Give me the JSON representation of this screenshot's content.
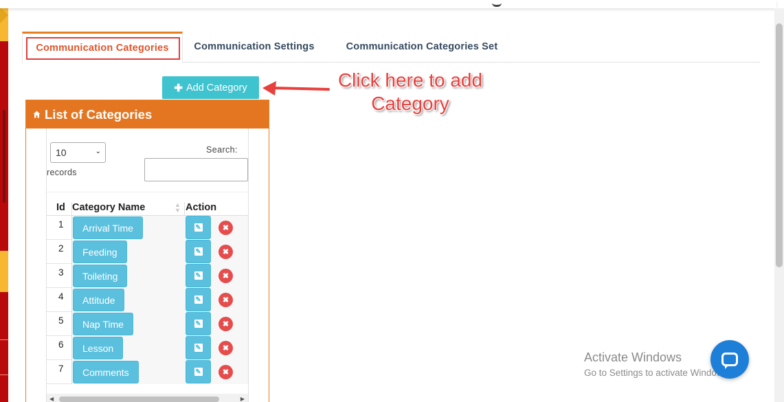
{
  "tabs": [
    {
      "label": "Communication Categories",
      "active": true
    },
    {
      "label": "Communication Settings",
      "active": false
    },
    {
      "label": "Communication Categories Set",
      "active": false
    }
  ],
  "add_button": {
    "icon": "plus-icon",
    "label": "Add Category"
  },
  "annotation": {
    "line1": "Click here to add",
    "line2": "Category",
    "color": "#e8403c"
  },
  "panel": {
    "title": "List of Categories",
    "title_icon": "home-icon",
    "header_color": "#e47622",
    "records_value": "10",
    "records_label": "records",
    "search_label": "Search:",
    "columns": {
      "id": "Id",
      "name": "Category Name",
      "action": "Action"
    },
    "rows": [
      {
        "id": "1",
        "name": "Arrival Time"
      },
      {
        "id": "2",
        "name": "Feeding"
      },
      {
        "id": "3",
        "name": "Toileting"
      },
      {
        "id": "4",
        "name": "Attitude"
      },
      {
        "id": "5",
        "name": "Nap Time"
      },
      {
        "id": "6",
        "name": "Lesson"
      },
      {
        "id": "7",
        "name": "Comments"
      }
    ]
  },
  "watermark": {
    "line1": "Activate Windows",
    "line2": "Go to Settings to activate Windows."
  },
  "colors": {
    "accent": "#e67e22",
    "button": "#5bc0de",
    "delete": "#e74c4c",
    "add": "#3fc3cf"
  }
}
